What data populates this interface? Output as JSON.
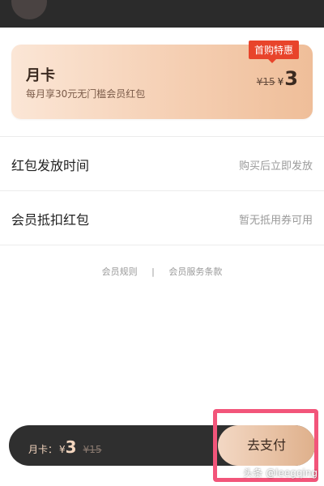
{
  "card": {
    "title": "月卡",
    "subtitle": "每月享30元无门槛会员红包",
    "badge": "首购特惠",
    "old_price": "¥15",
    "currency": "¥",
    "price": "3"
  },
  "rows": [
    {
      "label": "红包发放时间",
      "value": "购买后立即发放"
    },
    {
      "label": "会员抵扣红包",
      "value": "暂无抵用券可用"
    }
  ],
  "links": {
    "rules": "会员规则",
    "separator": "|",
    "terms": "会员服务条款"
  },
  "pay_bar": {
    "label": "月卡：",
    "currency": "¥",
    "price": "3",
    "old_price": "¥15",
    "button": "去支付"
  },
  "watermark": "头条 @leegqing",
  "colors": {
    "badge": "#e8442b",
    "highlight": "#f2557a",
    "pay_bar": "#2f2f2f"
  }
}
